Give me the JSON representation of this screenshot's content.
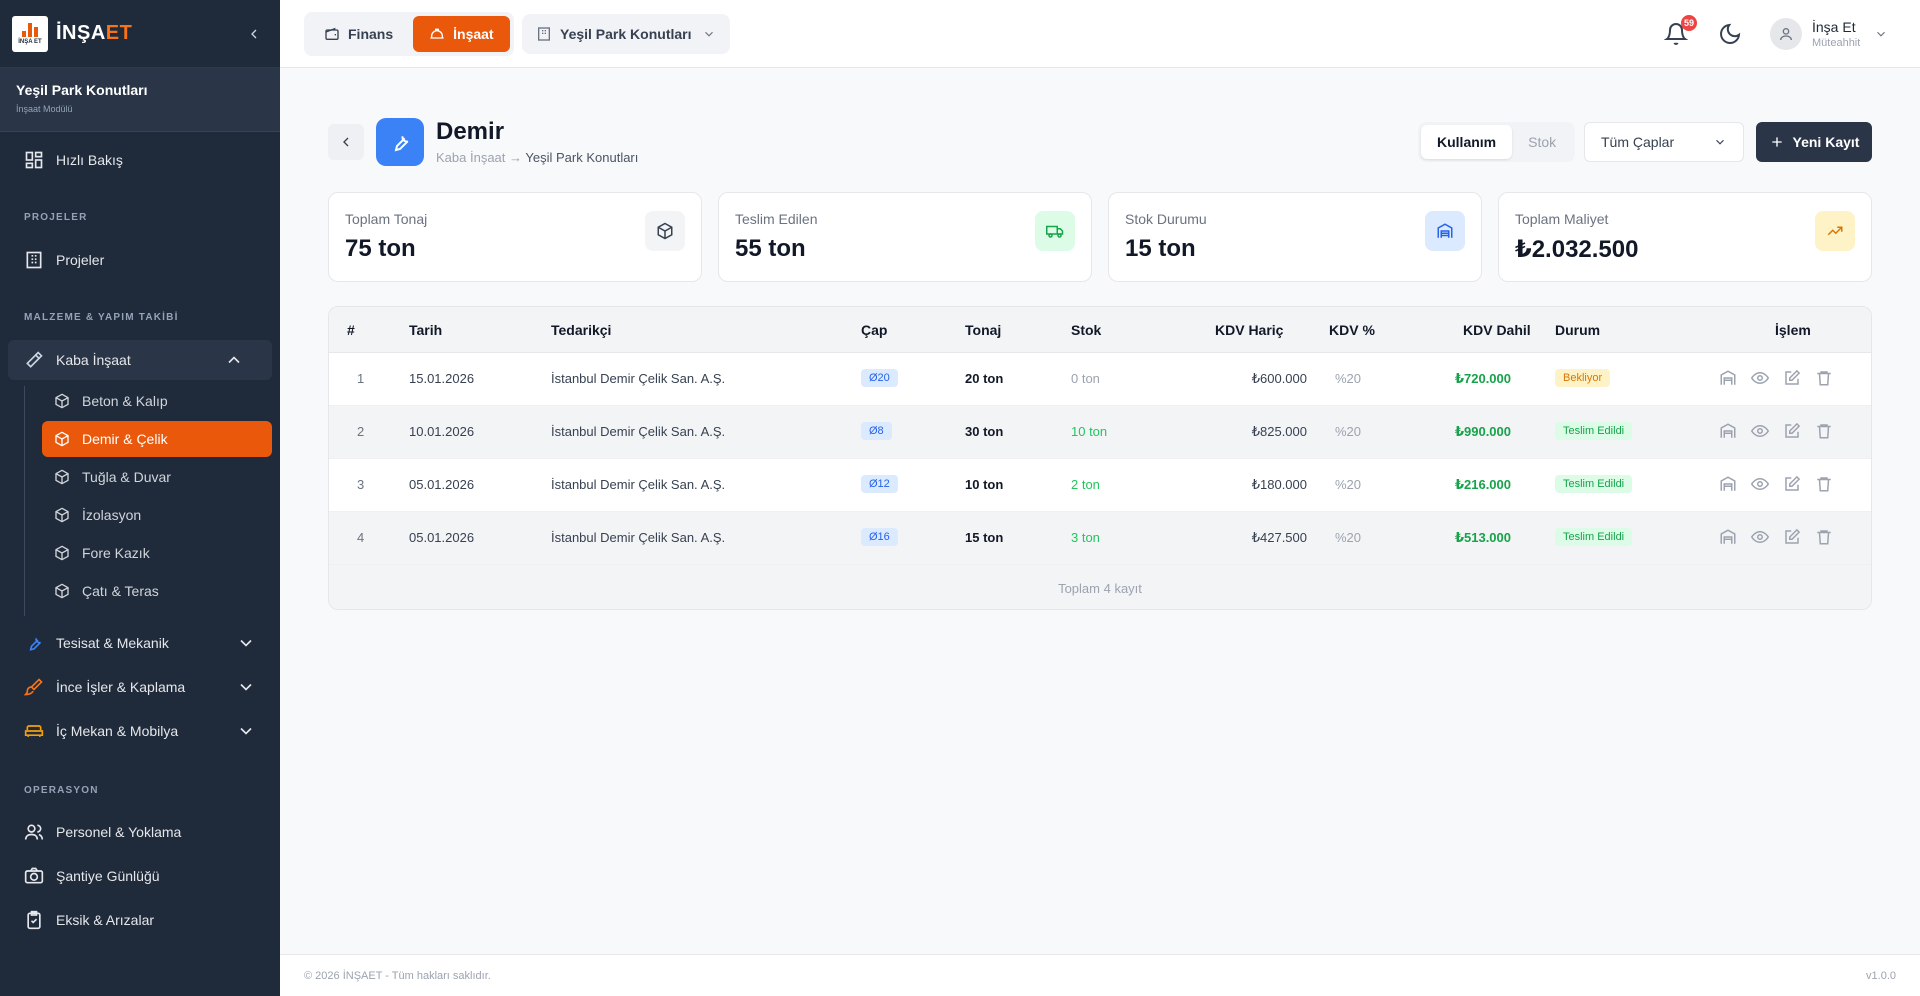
{
  "app": {
    "brand_a": "İNŞA",
    "brand_b": "ET",
    "logo_mini": "İNŞA ET"
  },
  "sidebar": {
    "project_name": "Yeşil Park Konutları",
    "project_sub": "İnşaat Modülü",
    "quick_view": "Hızlı Bakış",
    "section_projects": "PROJELER",
    "projects": "Projeler",
    "section_material": "MALZEME & YAPIM TAKİBİ",
    "kaba": "Kaba İnşaat",
    "sub_items": [
      "Beton & Kalıp",
      "Demir & Çelik",
      "Tuğla & Duvar",
      "İzolasyon",
      "Fore Kazık",
      "Çatı & Teras"
    ],
    "tesisat": "Tesisat & Mekanik",
    "ince": "İnce İşler & Kaplama",
    "icmekan": "İç Mekan & Mobilya",
    "section_ops": "OPERASYON",
    "personel": "Personel & Yoklama",
    "gunluk": "Şantiye Günlüğü",
    "eksik": "Eksik & Arızalar"
  },
  "topbar": {
    "finans": "Finans",
    "insaat": "İnşaat",
    "project_select": "Yeşil Park Konutları",
    "notif_count": "59",
    "user_name": "İnşa Et",
    "user_role": "Müteahhit"
  },
  "header": {
    "title": "Demir",
    "crumb_a": "Kaba İnşaat",
    "crumb_arrow": "→",
    "crumb_b": "Yeşil Park Konutları",
    "toggle_use": "Kullanım",
    "toggle_stock": "Stok",
    "filter": "Tüm Çaplar",
    "new_btn": "Yeni Kayıt"
  },
  "cards": [
    {
      "label": "Toplam Tonaj",
      "value": "75 ton"
    },
    {
      "label": "Teslim Edilen",
      "value": "55 ton"
    },
    {
      "label": "Stok Durumu",
      "value": "15 ton"
    },
    {
      "label": "Toplam Maliyet",
      "value": "₺2.032.500"
    }
  ],
  "table": {
    "headers": [
      "#",
      "Tarih",
      "Tedarikçi",
      "Çap",
      "Tonaj",
      "Stok",
      "KDV Hariç",
      "KDV %",
      "KDV Dahil",
      "Durum",
      "İşlem"
    ],
    "rows": [
      {
        "n": "1",
        "date": "15.01.2026",
        "supplier": "İstanbul Demir Çelik San. A.Ş.",
        "cap": "Ø20",
        "tonaj": "20 ton",
        "stok": "0 ton",
        "net": "₺600.000",
        "kdv": "%20",
        "gross": "₺720.000",
        "status": "Bekliyor"
      },
      {
        "n": "2",
        "date": "10.01.2026",
        "supplier": "İstanbul Demir Çelik San. A.Ş.",
        "cap": "Ø8",
        "tonaj": "30 ton",
        "stok": "10 ton",
        "net": "₺825.000",
        "kdv": "%20",
        "gross": "₺990.000",
        "status": "Teslim Edildi"
      },
      {
        "n": "3",
        "date": "05.01.2026",
        "supplier": "İstanbul Demir Çelik San. A.Ş.",
        "cap": "Ø12",
        "tonaj": "10 ton",
        "stok": "2 ton",
        "net": "₺180.000",
        "kdv": "%20",
        "gross": "₺216.000",
        "status": "Teslim Edildi"
      },
      {
        "n": "4",
        "date": "05.01.2026",
        "supplier": "İstanbul Demir Çelik San. A.Ş.",
        "cap": "Ø16",
        "tonaj": "15 ton",
        "stok": "3 ton",
        "net": "₺427.500",
        "kdv": "%20",
        "gross": "₺513.000",
        "status": "Teslim Edildi"
      }
    ],
    "footer": "Toplam 4 kayıt"
  },
  "footer": {
    "copyright": "© 2026 İNŞAET - Tüm hakları saklıdır.",
    "version": "v1.0.0"
  },
  "colors": {
    "accent": "#ea580c",
    "sidebar": "#1f2a3a",
    "primary_dark": "#2a3647"
  }
}
